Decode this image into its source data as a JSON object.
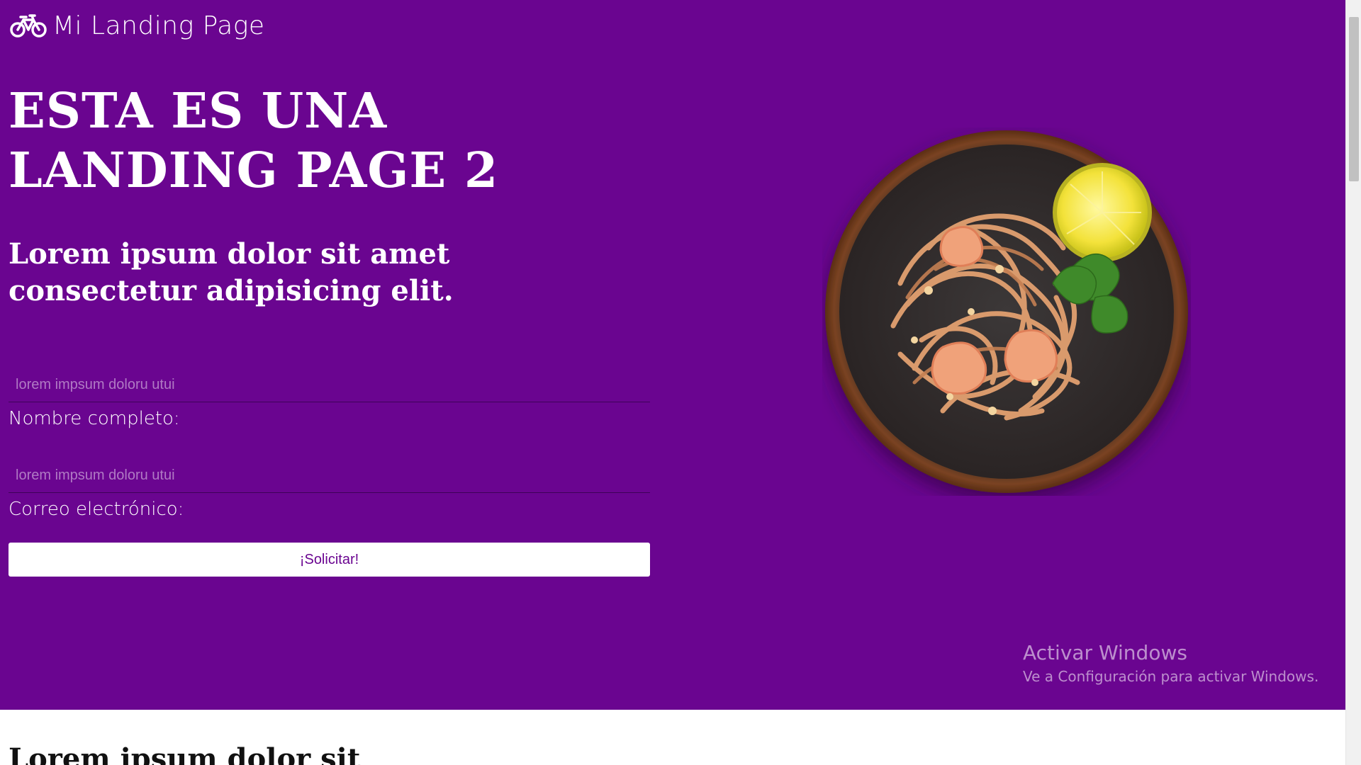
{
  "header": {
    "brand_icon": "bicycle-icon",
    "brand_text": "Mi Landing Page"
  },
  "hero": {
    "headline": "ESTA ES UNA LANDING PAGE 2",
    "subheadline": "Lorem ipsum dolor sit amet consectetur adipisicing elit.",
    "image": "pad-thai-dish-photo"
  },
  "form": {
    "name": {
      "placeholder": "lorem impsum doloru utui",
      "value": "",
      "label": "Nombre completo:"
    },
    "email": {
      "placeholder": "lorem impsum doloru utui",
      "value": "",
      "label": "Correo electrónico:"
    },
    "submit_label": "¡Solicitar!"
  },
  "watermark": {
    "title": "Activar Windows",
    "subtitle": "Ve a Configuración para activar Windows."
  },
  "section2": {
    "heading": "Lorem ipsum dolor sit"
  },
  "colors": {
    "hero_background": "#6a0590",
    "button_background": "#ffffff",
    "button_text": "#6a0590"
  }
}
